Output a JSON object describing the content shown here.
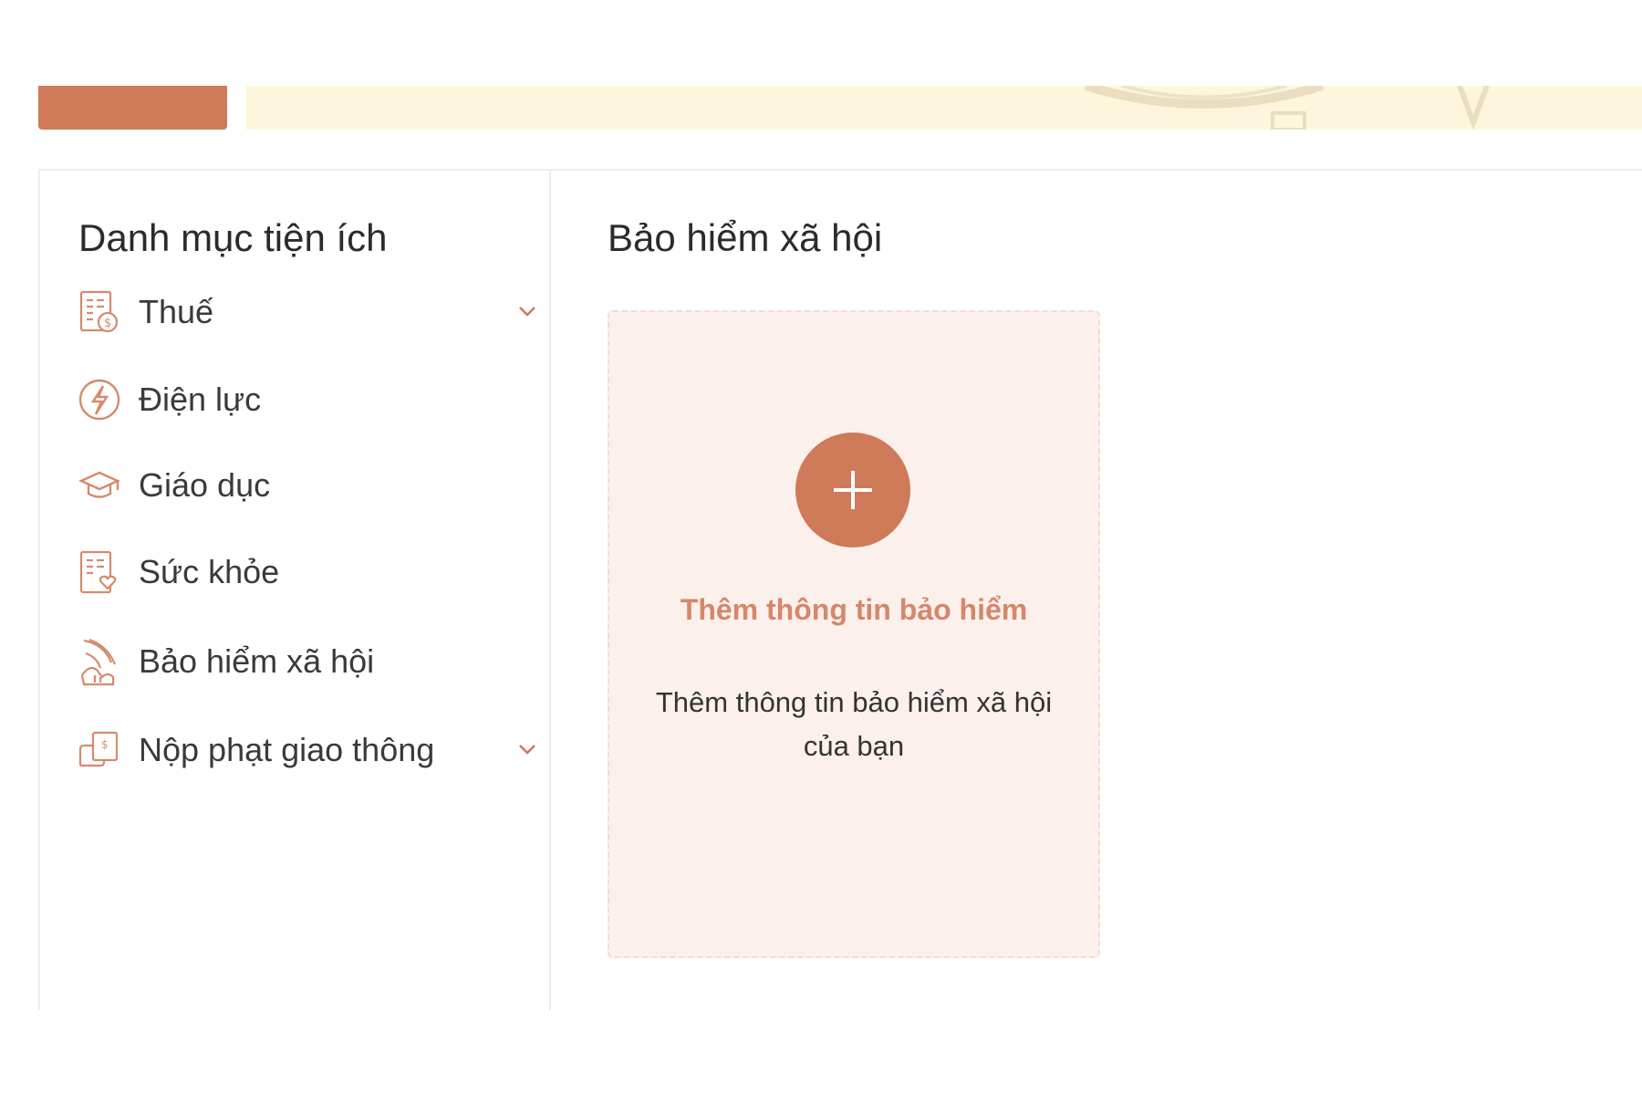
{
  "colors": {
    "accent": "#cf7a58",
    "banner": "#fdf6dc",
    "card_bg": "#fbf0ec",
    "card_heading": "#d6876a"
  },
  "sidebar": {
    "title": "Danh mục tiện ích",
    "items": [
      {
        "label": "Thuế",
        "icon": "tax-document-icon",
        "has_submenu": true
      },
      {
        "label": "Điện lực",
        "icon": "lightning-icon",
        "has_submenu": false
      },
      {
        "label": "Giáo dục",
        "icon": "graduation-cap-icon",
        "has_submenu": false
      },
      {
        "label": "Sức khỏe",
        "icon": "health-record-icon",
        "has_submenu": false
      },
      {
        "label": "Bảo hiểm xã hội",
        "icon": "social-insurance-icon",
        "has_submenu": false
      },
      {
        "label": "Nộp phạt giao thông",
        "icon": "traffic-fine-icon",
        "has_submenu": true
      }
    ]
  },
  "main": {
    "title": "Bảo hiểm xã hội",
    "add_card": {
      "heading": "Thêm thông tin bảo hiểm",
      "description": "Thêm thông tin bảo hiểm xã hội của bạn",
      "icon": "plus-icon"
    }
  }
}
